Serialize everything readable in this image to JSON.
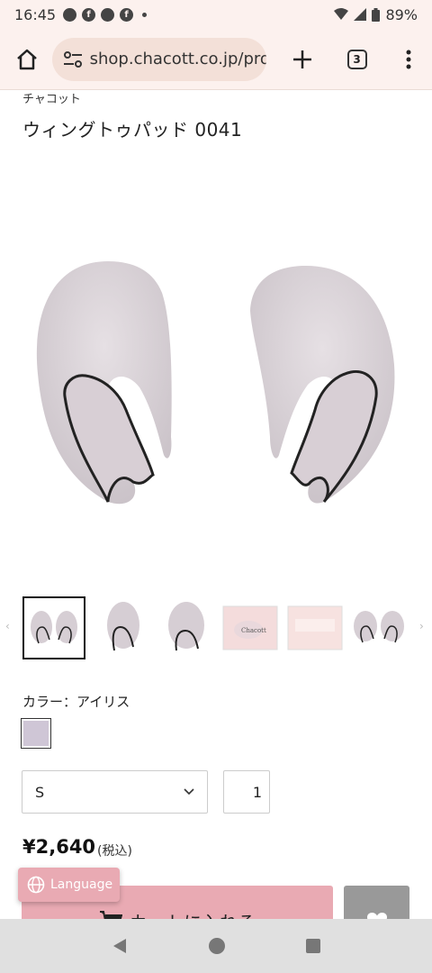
{
  "status_bar": {
    "time": "16:45",
    "battery": "89%",
    "notification_icons": [
      "ring-icon",
      "facebook-icon",
      "messenger-icon",
      "facebook-icon"
    ]
  },
  "browser": {
    "url": "shop.chacott.co.jp/pro",
    "tab_count": "3"
  },
  "product": {
    "brand": "チャコット",
    "title": "ウィングトゥパッド 0041",
    "color_label": "カラー：アイリス",
    "swatch_color": "#cfc6d6",
    "size_selected": "S",
    "quantity": "1",
    "price": "¥2,640",
    "tax_note": "(税込)"
  },
  "thumbnails": [
    {
      "name": "thumb-pair"
    },
    {
      "name": "thumb-side"
    },
    {
      "name": "thumb-single"
    },
    {
      "name": "thumb-package-front",
      "package_text": "Chacott"
    },
    {
      "name": "thumb-package-back"
    },
    {
      "name": "thumb-pair-small"
    }
  ],
  "actions": {
    "cart_label": "カートに入れる",
    "language_label": "Language"
  },
  "colors": {
    "accent_pink": "#e9aab3",
    "browser_chrome": "#fcf1ee",
    "pad_fabric": "#dcd5da"
  }
}
